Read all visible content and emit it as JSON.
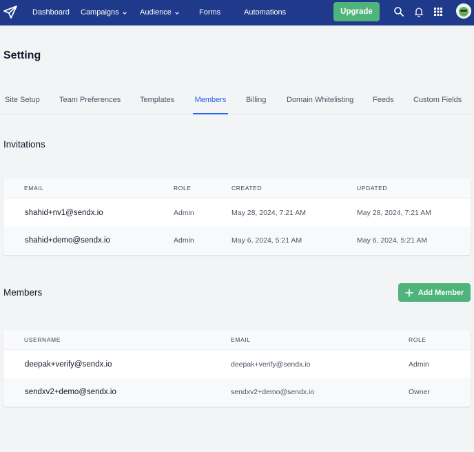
{
  "nav": {
    "items": [
      {
        "label": "Dashboard"
      },
      {
        "label": "Campaigns"
      },
      {
        "label": "Audience"
      },
      {
        "label": "Forms"
      },
      {
        "label": "Automations"
      }
    ],
    "upgrade_label": "Upgrade",
    "icons": [
      "paper-plane-logo-icon",
      "search-icon",
      "bell-icon",
      "apps-grid-icon",
      "avatar"
    ]
  },
  "page": {
    "title": "Setting"
  },
  "tabs": [
    {
      "label": "Site Setup"
    },
    {
      "label": "Team Preferences"
    },
    {
      "label": "Templates"
    },
    {
      "label": "Members",
      "active": true
    },
    {
      "label": "Billing"
    },
    {
      "label": "Domain Whitelisting"
    },
    {
      "label": "Feeds"
    },
    {
      "label": "Custom Fields"
    }
  ],
  "invitations": {
    "title": "Invitations",
    "columns": [
      "EMAIL",
      "ROLE",
      "CREATED",
      "UPDATED"
    ],
    "rows": [
      {
        "email": "shahid+nv1@sendx.io",
        "role": "Admin",
        "created": "May 28, 2024, 7:21 AM",
        "updated": "May 28, 2024, 7:21 AM"
      },
      {
        "email": "shahid+demo@sendx.io",
        "role": "Admin",
        "created": "May 6, 2024, 5:21 AM",
        "updated": "May 6, 2024, 5:21 AM"
      }
    ]
  },
  "members": {
    "title": "Members",
    "add_label": "Add Member",
    "columns": [
      "USERNAME",
      "EMAIL",
      "ROLE"
    ],
    "rows": [
      {
        "username": "deepak+verify@sendx.io",
        "email": "deepak+verify@sendx.io",
        "role": "Admin"
      },
      {
        "username": "sendxv2+demo@sendx.io",
        "email": "sendxv2+demo@sendx.io",
        "role": "Owner"
      }
    ]
  },
  "colors": {
    "nav_bg": "#1f3a8a",
    "accent_green": "#4fb37c",
    "active_tab": "#2563eb"
  }
}
